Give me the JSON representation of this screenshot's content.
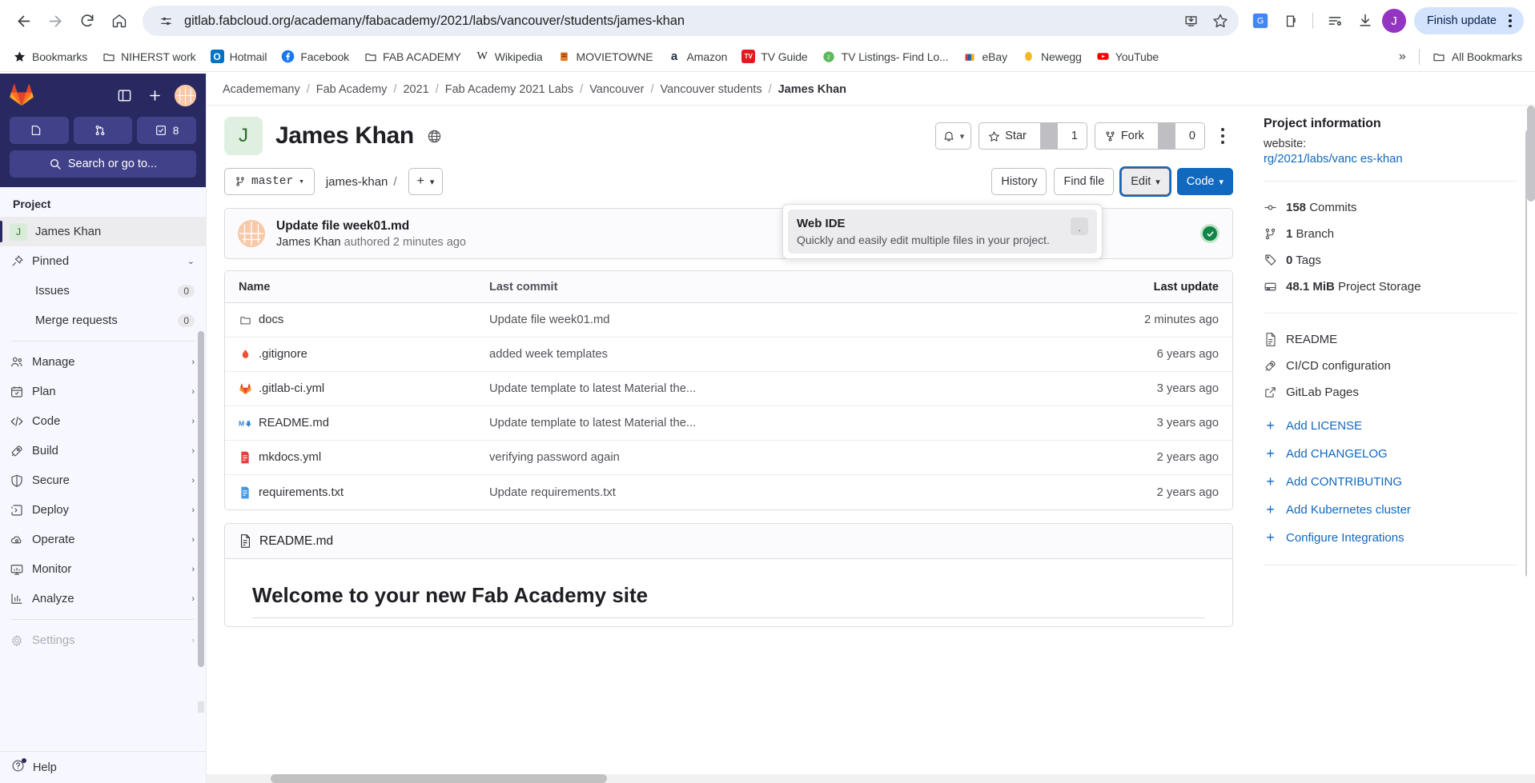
{
  "browser": {
    "url": "gitlab.fabcloud.org/academany/fabacademy/2021/labs/vancouver/students/james-khan",
    "back_label": "Back",
    "forward_label": "Forward",
    "reload_label": "Reload",
    "home_label": "Home",
    "site_info_label": "View site information",
    "install_label": "Install page as app",
    "bookmark_label": "Bookmark this tab",
    "translate_label": "Translate this page",
    "extensions_label": "Extensions",
    "reading_list_label": "Reading list",
    "downloads_label": "Downloads",
    "profile_initial": "J",
    "finish_update_label": "Finish update",
    "chrome_menu_label": "Customize and control Google Chrome",
    "bookmarks": [
      {
        "label": "Bookmarks",
        "icon": "star-icon"
      },
      {
        "label": "NIHERST work",
        "icon": "folder-icon"
      },
      {
        "label": "Hotmail",
        "icon": "outlook-icon"
      },
      {
        "label": "Facebook",
        "icon": "facebook-icon"
      },
      {
        "label": "FAB ACADEMY",
        "icon": "folder-icon"
      },
      {
        "label": "Wikipedia",
        "icon": "wikipedia-icon"
      },
      {
        "label": "MOVIETOWNE",
        "icon": "movietowne-icon"
      },
      {
        "label": "Amazon",
        "icon": "amazon-icon"
      },
      {
        "label": "TV Guide",
        "icon": "tvguide-icon"
      },
      {
        "label": "TV Listings- Find Lo...",
        "icon": "zap2it-icon"
      },
      {
        "label": "eBay",
        "icon": "ebay-icon"
      },
      {
        "label": "Newegg",
        "icon": "newegg-icon"
      },
      {
        "label": "YouTube",
        "icon": "youtube-icon"
      }
    ],
    "overflow_label": "»",
    "all_bookmarks_label": "All Bookmarks"
  },
  "sidebar": {
    "logo_label": "GitLab",
    "toggle_label": "Primary navigation",
    "create_label": "Create new...",
    "avatar_label": "James Khan",
    "counts": [
      {
        "name": "issues-counter",
        "value": "",
        "icon": "issue-icon"
      },
      {
        "name": "merge-requests-counter",
        "value": "",
        "icon": "merge-request-icon"
      },
      {
        "name": "todos-counter",
        "value": "8",
        "icon": "todo-icon"
      }
    ],
    "search_label": "Search or go to...",
    "section_title": "Project",
    "project_name": "James Khan",
    "project_initial": "J",
    "items": [
      {
        "label": "Pinned",
        "icon": "pin-icon",
        "chevron": "⌄",
        "badge": ""
      },
      {
        "label": "Issues",
        "icon": "",
        "badge": "0",
        "sub": true
      },
      {
        "label": "Merge requests",
        "icon": "",
        "badge": "0",
        "sub": true
      },
      {
        "label": "Manage",
        "icon": "users-icon",
        "chevron": "›"
      },
      {
        "label": "Plan",
        "icon": "calendar-icon",
        "chevron": "›"
      },
      {
        "label": "Code",
        "icon": "code-icon",
        "chevron": "›"
      },
      {
        "label": "Build",
        "icon": "rocket-icon",
        "chevron": "›"
      },
      {
        "label": "Secure",
        "icon": "shield-icon",
        "chevron": "›"
      },
      {
        "label": "Deploy",
        "icon": "deploy-icon",
        "chevron": "›"
      },
      {
        "label": "Operate",
        "icon": "cloud-gear-icon",
        "chevron": "›"
      },
      {
        "label": "Monitor",
        "icon": "monitor-icon",
        "chevron": "›"
      },
      {
        "label": "Analyze",
        "icon": "chart-icon",
        "chevron": "›"
      },
      {
        "label": "Settings",
        "icon": "gear-icon",
        "chevron": "›"
      }
    ],
    "help_label": "Help"
  },
  "breadcrumb": [
    "Academemany",
    "Fab Academy",
    "2021",
    "Fab Academy 2021 Labs",
    "Vancouver",
    "Vancouver students",
    "James Khan"
  ],
  "project": {
    "avatar_initial": "J",
    "title": "James Khan",
    "visibility_icon": "globe-icon",
    "notifications_label": "Notification setting",
    "star_label": "Star",
    "star_count": "1",
    "fork_label": "Fork",
    "fork_count": "0",
    "more_label": "More actions"
  },
  "repo_toolbar": {
    "branch": "master",
    "path": "james-khan",
    "path_sep": "/",
    "add_label": "+",
    "history_label": "History",
    "find_file_label": "Find file",
    "edit_label": "Edit",
    "code_label": "Code"
  },
  "webide_dropdown": {
    "title": "Web IDE",
    "description": "Quickly and easily edit multiple files in your project.",
    "shortcut": "."
  },
  "commit": {
    "title": "Update file week01.md",
    "author": "James Khan",
    "meta": "authored 2 minutes ago",
    "pipeline_status": "passed"
  },
  "file_table": {
    "headers": {
      "name": "Name",
      "commit": "Last commit",
      "update": "Last update"
    },
    "rows": [
      {
        "name": "docs",
        "icon": "folder-icon",
        "commit": "Update file week01.md",
        "update": "2 minutes ago"
      },
      {
        "name": ".gitignore",
        "icon": "git-icon",
        "commit": "added week templates",
        "update": "6 years ago"
      },
      {
        "name": ".gitlab-ci.yml",
        "icon": "gitlab-icon",
        "commit": "Update template to latest Material the...",
        "update": "3 years ago"
      },
      {
        "name": "README.md",
        "icon": "markdown-icon",
        "commit": "Update template to latest Material the...",
        "update": "3 years ago"
      },
      {
        "name": "mkdocs.yml",
        "icon": "yaml-icon",
        "commit": "verifying password again",
        "update": "2 years ago"
      },
      {
        "name": "requirements.txt",
        "icon": "text-icon",
        "commit": "Update requirements.txt",
        "update": "2 years ago"
      }
    ]
  },
  "readme": {
    "filename": "README.md",
    "heading": "Welcome to your new Fab Academy site"
  },
  "project_information": {
    "title": "Project information",
    "website_label": "website:",
    "website_url": "rg/2021/labs/vanc es-khan",
    "stats": [
      {
        "value": "158",
        "label": "Commits",
        "icon": "commit-icon"
      },
      {
        "value": "1",
        "label": "Branch",
        "icon": "branch-icon"
      },
      {
        "value": "0",
        "label": "Tags",
        "icon": "tag-icon"
      },
      {
        "value": "48.1 MiB",
        "label": "Project Storage",
        "icon": "storage-icon"
      }
    ],
    "links": [
      {
        "label": "README",
        "icon": "doc-icon"
      },
      {
        "label": "CI/CD configuration",
        "icon": "rocket-icon"
      },
      {
        "label": "GitLab Pages",
        "icon": "external-link-icon"
      }
    ],
    "add_links": [
      {
        "label": "Add LICENSE"
      },
      {
        "label": "Add CHANGELOG"
      },
      {
        "label": "Add CONTRIBUTING"
      },
      {
        "label": "Add Kubernetes cluster"
      },
      {
        "label": "Configure Integrations"
      }
    ]
  },
  "colors": {
    "gitlab_purple": "#292961",
    "primary_blue": "#1068bf",
    "success_green": "#108548",
    "link_blue": "#1068bf"
  }
}
